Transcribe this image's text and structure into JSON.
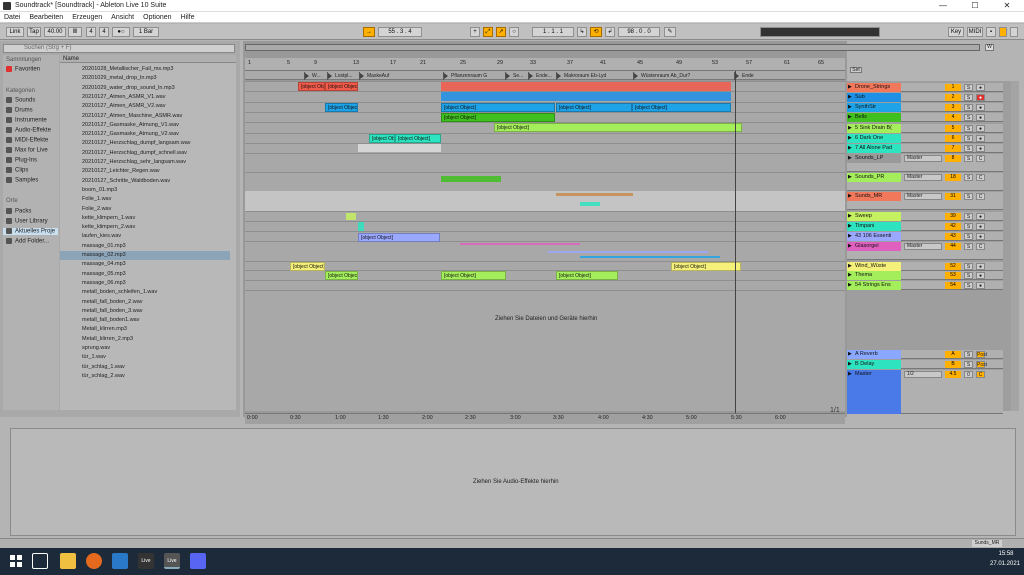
{
  "window": {
    "title": "Soundtrack* [Soundtrack] - Ableton Live 10 Suite",
    "minimize": "—",
    "maximize": "☐",
    "close": "✕"
  },
  "menu": [
    "Datei",
    "Bearbeiten",
    "Erzeugen",
    "Ansicht",
    "Optionen",
    "Hilfe"
  ],
  "transport": {
    "link": "Link",
    "tap": "Tap",
    "tempo": "40.00",
    "sig_num": "4",
    "sig_den": "4",
    "metro": "1 Bar",
    "position": "55 . 3 . 4",
    "loop_start": "1 . 1 . 1",
    "loop_len": "98 . 0 . 0",
    "key": "Key",
    "midi": "MIDI",
    "zoom_label": "W"
  },
  "browser": {
    "search_placeholder": "Suchen (Strg + F)",
    "col_name": "Name",
    "sections": {
      "collections": "Sammlungen",
      "categories": "Kategorien",
      "places": "Orte"
    },
    "collection_items": [
      "Favoriten"
    ],
    "category_items": [
      "Sounds",
      "Drums",
      "Instrumente",
      "Audio-Effekte",
      "MIDI-Effekte",
      "Max for Live",
      "Plug-Ins",
      "Clips",
      "Samples"
    ],
    "place_items": [
      "Packs",
      "User Library",
      "Aktuelles Proje",
      "Add Folder..."
    ],
    "files": [
      "20201028_Metallischer_Fall_ms.mp3",
      "20201029_metal_drop_ln.mp3",
      "20201029_water_drop_sound_ln.mp3",
      "20210127_Atmen_ASMR_V1.wav",
      "20210127_Atmen_ASMR_V2.wav",
      "20210127_Atmen_Maschine_ASMR.wav",
      "20210127_Gasmaske_Atmung_V1.wav",
      "20210127_Gasmaske_Atmung_V2.wav",
      "20210127_Herzschlag_dumpf_langsam.wav",
      "20210127_Herzschlag_dumpf_schnell.wav",
      "20210127_Herzschlag_sehr_langsam.wav",
      "20210127_Leichter_Regen.wav",
      "20210127_Schritte_Waldboden.wav",
      "boom_01.mp3",
      "Folie_1.wav",
      "Folie_2.wav",
      "kette_klimpern_1.wav",
      "kette_klimpern_2.wav",
      "laufen_kies.wav",
      "massage_01.mp3",
      "massage_02.mp3",
      "massage_04.mp3",
      "massage_05.mp3",
      "massage_06.mp3",
      "metall_boden_schleifen_1.wav",
      "metall_fall_boden_2.wav",
      "metall_fall_boden_3.wav",
      "metall_fall_boden1.wav",
      "Metall_klirren.mp3",
      "Metall_klirren_2.mp3",
      "sprung.wav",
      "tür_1.wav",
      "tür_schlag_1.wav",
      "tür_schlag_2.wav"
    ],
    "selected_file": "massage_02.mp3"
  },
  "ruler": [
    "1",
    "5",
    "9",
    "13",
    "17",
    "21",
    "25",
    "29",
    "33",
    "37",
    "41",
    "45",
    "49",
    "53",
    "57",
    "61",
    "65"
  ],
  "locators": [
    "W...",
    "Lostpl...",
    "MaskeAuf",
    "Pflanzenraum G",
    "Se...",
    "Ende...",
    "Makroraum Eb-Lyd",
    "Wüstenraum Ab_Dur?",
    "Ende"
  ],
  "clips": [
    {
      "label": "1-Double S",
      "color": "#f25a4a"
    },
    {
      "label": "",
      "color": "#f25a4a"
    },
    {
      "label": "2-Strings Sc",
      "color": "#1fa3e8"
    },
    {
      "label": "2-Strings Sordino (C1-G6) 3",
      "color": "#1fa3e8"
    },
    {
      "label": "2-Strings Sordino (C1-G6) 4",
      "color": "#1fa3e8"
    },
    {
      "label": "2-Strings Sordino (C1-G6) 6",
      "color": "#1fa3e8"
    },
    {
      "label": "3-Bell E Piano 4",
      "color": "#3fc01f"
    },
    {
      "label": "4-Sink Drain B(Loop) 5",
      "color": "#a4ee5c"
    },
    {
      "label": "5-Dark One 1",
      "color": "#2ee3c0"
    },
    {
      "label": "5-Dark One 3",
      "color": "#2ee3c0"
    },
    {
      "label": "10-106 Essential 1",
      "color": "#9aa8ff"
    },
    {
      "label": "20201028_Gr",
      "color": "#f5f07a"
    },
    {
      "label": "20201028_Grundstimmung",
      "color": "#f5f07a"
    },
    {
      "label": "Thema 5",
      "color": "#a4ee5c"
    },
    {
      "label": "Thema 2",
      "color": "#a4ee5c"
    },
    {
      "label": "Thema 4",
      "color": "#a4ee5c"
    }
  ],
  "arrangement_drop_hint": "Ziehen Sie Dateien und Geräte hierhin",
  "page_indicator": "1/1",
  "time_ticks": [
    "0:00",
    "0:30",
    "1:00",
    "1:30",
    "2:00",
    "2:30",
    "3:00",
    "3:30",
    "4:00",
    "4:30",
    "5:00",
    "5:30",
    "6:00"
  ],
  "tracks": [
    {
      "name": "Drone_Strings",
      "color": "#f2785c",
      "vol": "1",
      "solo": "S",
      "arm": "●"
    },
    {
      "name": "Sub",
      "color": "#1e90e6",
      "vol": "2",
      "solo": "S",
      "arm": "●"
    },
    {
      "name": "SynthStr",
      "color": "#1fa3e8",
      "vol": "3",
      "solo": "S",
      "arm": "●"
    },
    {
      "name": "Bells",
      "color": "#3fc01f",
      "vol": "4",
      "solo": "S",
      "arm": "●"
    },
    {
      "name": "5 Sink Drain B(",
      "color": "#a4ee5c",
      "vol": "5",
      "solo": "S",
      "arm": "●"
    },
    {
      "name": "6 Dark One",
      "color": "#2ee3c0",
      "vol": "6",
      "solo": "S",
      "arm": "●"
    },
    {
      "name": "7 All Alone Pad",
      "color": "#2ee3c0",
      "vol": "7",
      "solo": "S",
      "arm": "●"
    },
    {
      "name": "Sounds_LP",
      "color": "#9a9a9a",
      "vol": "8",
      "solo": "S",
      "arm": "C",
      "route": "Master"
    },
    {
      "name": "Sounds_PR",
      "color": "#a4ee5c",
      "vol": "18",
      "solo": "S",
      "arm": "C",
      "route": "Master"
    },
    {
      "name": "Sunds_MR",
      "color": "#f2785c",
      "vol": "31",
      "solo": "S",
      "arm": "C",
      "route": "Master"
    },
    {
      "name": "Sweep",
      "color": "#c5f060",
      "vol": "39",
      "solo": "S",
      "arm": "●"
    },
    {
      "name": "Timpani",
      "color": "#2ee3c0",
      "vol": "42",
      "solo": "S",
      "arm": "●"
    },
    {
      "name": "43 106 Essenti",
      "color": "#9aa8ff",
      "vol": "43",
      "solo": "S",
      "arm": "●"
    },
    {
      "name": "Glasorgel",
      "color": "#e060c0",
      "vol": "44",
      "solo": "S",
      "arm": "C",
      "route": "Master"
    },
    {
      "name": "Wind_Wüste",
      "color": "#f5f07a",
      "vol": "52",
      "solo": "S",
      "arm": "●"
    },
    {
      "name": "Thema",
      "color": "#a4ee5c",
      "vol": "53",
      "solo": "S",
      "arm": "●"
    },
    {
      "name": "54 Strings Ens",
      "color": "#a4ee5c",
      "vol": "54",
      "solo": "S",
      "arm": "●"
    }
  ],
  "returns": [
    {
      "name": "A Reverb",
      "color": "#8aa8ff",
      "vol": "A",
      "solo": "S",
      "post": "Post"
    },
    {
      "name": "B Delay",
      "color": "#2ee3c0",
      "vol": "B",
      "solo": "S",
      "post": "Post"
    },
    {
      "name": "Master",
      "color": "#4a7ae8",
      "vol": "4.5",
      "solo": "0",
      "post": "C",
      "route": "1/2"
    }
  ],
  "set_button": "Set",
  "device_drop_hint": "Ziehen Sie Audio-Effekte hierhin",
  "status_track": "Sunds_MR",
  "taskbar": {
    "time": "15:58",
    "date": "27.01.2021",
    "live_label": "Live",
    "live2_label": "Live"
  }
}
